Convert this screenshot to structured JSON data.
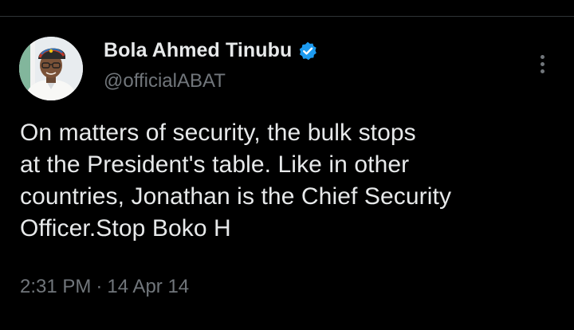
{
  "tweet": {
    "author": {
      "display_name": "Bola Ahmed Tinubu",
      "handle": "@officialABAT",
      "verified": true,
      "verified_color": "#1d9bf0",
      "avatar_icon": "profile-photo"
    },
    "text": "On matters of security, the bulk stops\nat the President's table. Like in other\ncountries, Jonathan is the Chief Security\nOfficer.Stop Boko H",
    "time": "2:31 PM",
    "separator": "·",
    "date": "14 Apr 14",
    "more_icon": "more-vertical-icon"
  },
  "theme": {
    "background": "#000000",
    "primary_text": "#e7e9ea",
    "secondary_text": "#71767b",
    "divider": "#2f3336"
  }
}
